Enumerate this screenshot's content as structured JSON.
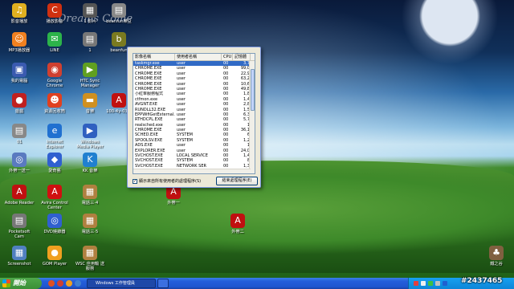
{
  "desktop": {
    "watermark": "Dreams Come",
    "icons": [
      {
        "label": "影音播放",
        "glyph": "♫",
        "color": "#e0b020"
      },
      {
        "label": "播放影音",
        "glyph": "C",
        "color": "#d03010"
      },
      {
        "label": "1 影片",
        "glyph": "▦",
        "color": "#555"
      },
      {
        "label": "beanfun樂豆",
        "glyph": "▤",
        "color": "#888"
      },
      {
        "label": "MP3播放器",
        "glyph": "☺",
        "color": "#f08020"
      },
      {
        "label": "LINE",
        "glyph": "✉",
        "color": "#2cb34a"
      },
      {
        "label": "1",
        "glyph": "▤",
        "color": "#777"
      },
      {
        "label": "beanfun",
        "glyph": "b",
        "color": "#7a7a20"
      },
      {
        "label": "我的電腦",
        "glyph": "▣",
        "color": "#3a5ab0"
      },
      {
        "label": "Google Chrome",
        "glyph": "◉",
        "color": "#d04030"
      },
      {
        "label": "HTC Sync Manager",
        "glyph": "▶",
        "color": "#60a020"
      },
      {
        "label": "遊戲",
        "glyph": "●",
        "color": "#c02020"
      },
      {
        "label": "資源回收筒",
        "glyph": "☻",
        "color": "#e04020"
      },
      {
        "label": "音樂",
        "glyph": "▬",
        "color": "#d09020"
      },
      {
        "label": "100-4y-03-2",
        "glyph": "A",
        "color": "#c01010"
      },
      {
        "label": "01",
        "glyph": "▤",
        "color": "#888"
      },
      {
        "label": "Internet Explorer",
        "glyph": "e",
        "color": "#2070d0"
      },
      {
        "label": "Windows Media Player",
        "glyph": "▶",
        "color": "#3060c0"
      },
      {
        "label": "外帶一送一",
        "glyph": "◎",
        "color": "#5a7ac0"
      },
      {
        "label": "愛奇藝",
        "glyph": "◆",
        "color": "#3060d0"
      },
      {
        "label": "KK 音樂",
        "glyph": "K",
        "color": "#2080d0"
      },
      {
        "label": "Adobe Reader",
        "glyph": "A",
        "color": "#c01010"
      },
      {
        "label": "Avira Control Center",
        "glyph": "A",
        "color": "#d01010"
      },
      {
        "label": "電話三·4",
        "glyph": "▦",
        "color": "#b08040"
      },
      {
        "label": "外帶一",
        "glyph": "A",
        "color": "#c01010"
      },
      {
        "label": "Pocketsoft Cam",
        "glyph": "▤",
        "color": "#777"
      },
      {
        "label": "DVD燒錄器",
        "glyph": "◎",
        "color": "#3060d0"
      },
      {
        "label": "電話三·5",
        "glyph": "▦",
        "color": "#b08040"
      },
      {
        "label": "外帶二",
        "glyph": "A",
        "color": "#c01010"
      },
      {
        "label": "Screenshot",
        "glyph": "▦",
        "color": "#5080c0"
      },
      {
        "label": "GOM Player",
        "glyph": "●",
        "color": "#f0a020"
      },
      {
        "label": "WSC 佳用輸 送服務",
        "glyph": "▦",
        "color": "#b08040"
      },
      {
        "label": "鐵之谷",
        "glyph": "♣",
        "color": "#806040"
      },
      {
        "label": "資源回收筒",
        "glyph": "♻",
        "color": "#5a8ac0"
      }
    ]
  },
  "task_manager": {
    "columns": [
      "影像名稱",
      "使用者名稱",
      "CPU",
      "記憶體"
    ],
    "processes": [
      [
        "taskmgr.exe",
        "user",
        "00",
        "3,7"
      ],
      [
        "CHROME.EXE",
        "user",
        "00",
        "99,0"
      ],
      [
        "CHROME.EXE",
        "user",
        "00",
        "22,9"
      ],
      [
        "CHROME.EXE",
        "user",
        "00",
        "63,2"
      ],
      [
        "CHROME.EXE",
        "user",
        "00",
        "10,6"
      ],
      [
        "CHROME.EXE",
        "user",
        "00",
        "49,8"
      ],
      [
        "小紅傘服務程式",
        "user",
        "00",
        "1,8"
      ],
      [
        "ctfmon.exe",
        "user",
        "00",
        "1,4"
      ],
      [
        "AVGNT.EXE",
        "user",
        "00",
        "2,8"
      ],
      [
        "RUNDLL32.EXE",
        "user",
        "00",
        "1,5"
      ],
      [
        "EPPWifiGetExternal.exe",
        "user",
        "00",
        "6,3"
      ],
      [
        "RTHDCPL.EXE",
        "user",
        "00",
        "5,7"
      ],
      [
        "realsched.exe",
        "user",
        "00",
        "1"
      ],
      [
        "CHROME.EXE",
        "user",
        "00",
        "36,1"
      ],
      [
        "SCHED.EXE",
        "SYSTEM",
        "00",
        "6"
      ],
      [
        "SPOOLSV.EXE",
        "SYSTEM",
        "00",
        "1,2"
      ],
      [
        "ADS.EXE",
        "user",
        "00",
        "1"
      ],
      [
        "EXPLORER.EXE",
        "user",
        "00",
        "24,0"
      ],
      [
        "SVCHOST.EXE",
        "LOCAL SERVICE",
        "00",
        "1,4"
      ],
      [
        "SVCHOST.EXE",
        "SYSTEM",
        "00",
        "8"
      ],
      [
        "SVCHOST.EXE",
        "NETWORK SER",
        "00",
        "1,3"
      ]
    ],
    "show_all_label": "顯示來自所有使用者的處理程序(S)",
    "end_process_label": "結束處理程序(E)"
  },
  "taskbar": {
    "start_label": "開始",
    "task_label": "Windows 工作管理員",
    "clock": ""
  },
  "stamp": "#2437465"
}
